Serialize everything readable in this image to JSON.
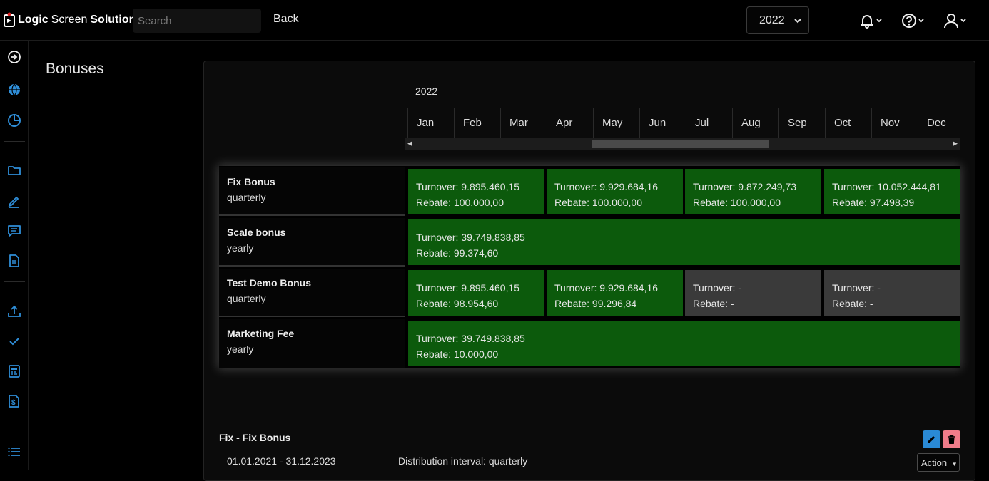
{
  "topbar": {
    "brand_logic": "Logic",
    "brand_screen": "Screen",
    "brand_solutions": "Solutions",
    "search_placeholder": "Search",
    "back_label": "Back",
    "year_value": "2022"
  },
  "page": {
    "title": "Bonuses"
  },
  "timeline": {
    "year": "2022",
    "months": [
      "Jan",
      "Feb",
      "Mar",
      "Apr",
      "May",
      "Jun",
      "Jul",
      "Aug",
      "Sep",
      "Oct",
      "Nov",
      "Dec"
    ]
  },
  "bonuses": [
    {
      "name": "Fix Bonus",
      "interval": "quarterly",
      "cells": [
        {
          "turnover": "Turnover: 9.895.460,15",
          "rebate": "Rebate: 100.000,00",
          "status": "green"
        },
        {
          "turnover": "Turnover: 9.929.684,16",
          "rebate": "Rebate: 100.000,00",
          "status": "green"
        },
        {
          "turnover": "Turnover: 9.872.249,73",
          "rebate": "Rebate: 100.000,00",
          "status": "green"
        },
        {
          "turnover": "Turnover: 10.052.444,81",
          "rebate": "Rebate: 97.498,39",
          "status": "green"
        }
      ]
    },
    {
      "name": "Scale bonus",
      "interval": "yearly",
      "cells": [
        {
          "turnover": "Turnover: 39.749.838,85",
          "rebate": "Rebate: 99.374,60",
          "status": "green"
        }
      ]
    },
    {
      "name": "Test Demo Bonus",
      "interval": "quarterly",
      "cells": [
        {
          "turnover": "Turnover: 9.895.460,15",
          "rebate": "Rebate: 98.954,60",
          "status": "green"
        },
        {
          "turnover": "Turnover: 9.929.684,16",
          "rebate": "Rebate: 99.296,84",
          "status": "green"
        },
        {
          "turnover": "Turnover: -",
          "rebate": "Rebate: -",
          "status": "gray"
        },
        {
          "turnover": "Turnover: -",
          "rebate": "Rebate: -",
          "status": "gray"
        }
      ]
    },
    {
      "name": "Marketing Fee",
      "interval": "yearly",
      "cells": [
        {
          "turnover": "Turnover: 39.749.838,85",
          "rebate": "Rebate: 10.000,00",
          "status": "green"
        }
      ]
    }
  ],
  "detail": {
    "name": "Fix - Fix Bonus",
    "dates": "01.01.2021 - 31.12.2023",
    "interval": "Distribution interval: quarterly",
    "action_label": "Action"
  },
  "icons": {
    "sidebar": [
      "arrow-right-circle-icon",
      "globe-icon",
      "pie-chart-icon",
      "folder-icon",
      "pencil-icon",
      "message-icon",
      "document-icon",
      "upload-icon",
      "check-icon",
      "calculator-icon",
      "invoice-icon",
      "list-icon"
    ],
    "topbar": [
      "bell-icon",
      "help-icon",
      "user-icon"
    ]
  },
  "colors": {
    "accent": "#2f8ed8",
    "cell_green": "#0c5a0c",
    "cell_gray": "#3a3a3a"
  }
}
